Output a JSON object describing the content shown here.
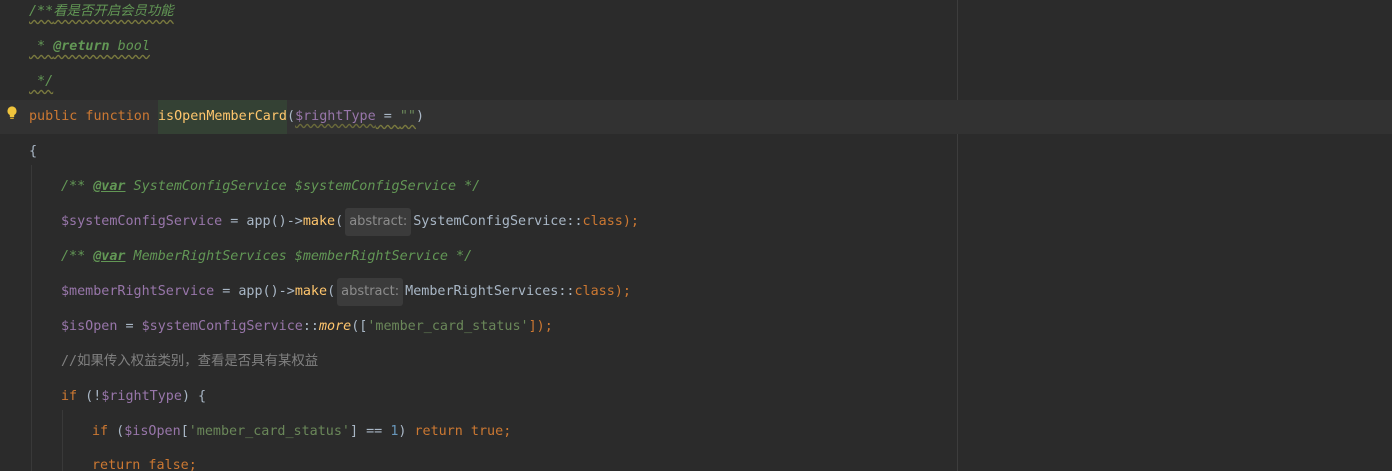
{
  "colors": {
    "background": "#2b2b2b",
    "keyword": "#cc7832",
    "variable": "#9876aa",
    "function": "#ffc66d",
    "string": "#6a8759",
    "number": "#6897bb",
    "doc_comment": "#629755",
    "line_comment": "#808080",
    "text": "#a9b7c6"
  },
  "icons": {
    "gutter_intention": "lightbulb-icon"
  },
  "code": {
    "l1": {
      "open": "/**",
      "text": "看是否开启会员功能"
    },
    "l2": {
      "star": " * ",
      "tag": "@return",
      "type": " bool"
    },
    "l3": {
      "close": " */"
    },
    "l4": {
      "kw_public": "public",
      "kw_function": " function ",
      "fn_name": "isOpenMemberCard",
      "paren_open": "(",
      "param": "$rightType",
      "assign": " = ",
      "default": "\"\"",
      "paren_close": ")"
    },
    "l5": {
      "brace": "{"
    },
    "l6": {
      "open": "/** ",
      "tag": "@var",
      "rest": " SystemConfigService $systemConfigService */"
    },
    "l7": {
      "var": "$systemConfigService",
      "assign": " = app()->",
      "method": "make",
      "paren": "(",
      "hint": "abstract:",
      "cls": "SystemConfigService::",
      "kw_class": "class",
      "end": ");"
    },
    "l8": {
      "open": "/** ",
      "tag": "@var",
      "rest": " MemberRightServices $memberRightService */"
    },
    "l9": {
      "var": "$memberRightService",
      "assign": " = app()->",
      "method": "make",
      "paren": "(",
      "hint": "abstract:",
      "cls": "MemberRightServices::",
      "kw_class": "class",
      "end": ");"
    },
    "l10": {
      "var": "$isOpen",
      "assign": " = ",
      "var2": "$systemConfigService",
      "colons": "::",
      "method": "more",
      "open": "([",
      "str": "'member_card_status'",
      "close": "]);"
    },
    "l11": {
      "comment": "//如果传入权益类别，查看是否具有某权益"
    },
    "l12": {
      "kw_if": "if",
      "open": " (!",
      "var": "$rightType",
      "close": ") {"
    },
    "l13": {
      "kw_if": "if",
      "open": " (",
      "var": "$isOpen",
      "bracket": "[",
      "str": "'member_card_status'",
      "mid": "] == ",
      "num": "1",
      "paren": ") ",
      "kw_return": "return",
      "kw_true": " true",
      "semi": ";"
    },
    "l14": {
      "kw_return": "return",
      "kw_false": " false",
      "semi": ";"
    }
  }
}
